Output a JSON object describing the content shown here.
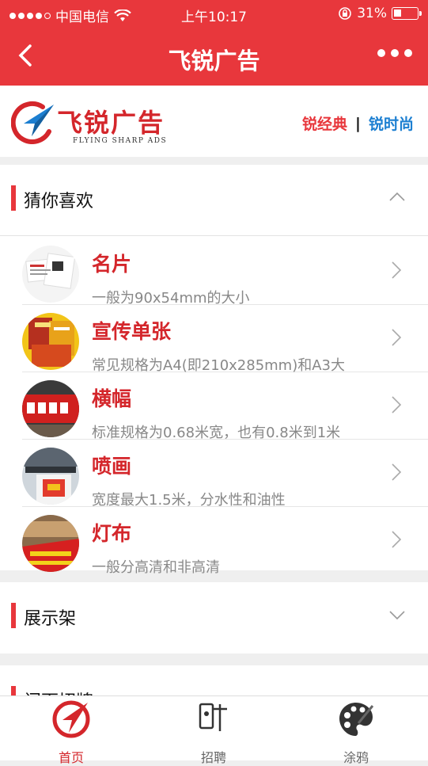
{
  "status": {
    "carrier": "中国电信",
    "time": "上午10:17",
    "battery": "31%"
  },
  "nav": {
    "title": "飞锐广告"
  },
  "header": {
    "brand_name": "飞锐广告",
    "brand_sub": "FLYING SHARP ADS",
    "link_a": "锐经典",
    "separator": "|",
    "link_b": "锐时尚"
  },
  "sections": [
    {
      "title": "猜你喜欢",
      "expanded": true
    },
    {
      "title": "展示架",
      "expanded": false
    },
    {
      "title": "门面招牌",
      "expanded": false
    }
  ],
  "items": [
    {
      "name": "名片",
      "desc": "一般为90x54mm的大小"
    },
    {
      "name": "宣传单张",
      "desc": "常见规格为A4(即210x285mm)和A3大"
    },
    {
      "name": "横幅",
      "desc": "标准规格为0.68米宽，也有0.8米到1米"
    },
    {
      "name": "喷画",
      "desc": "宽度最大1.5米，分水性和油性"
    },
    {
      "name": "灯布",
      "desc": "一般分高清和非高清"
    }
  ],
  "tabs": [
    {
      "label": "首页",
      "icon": "home-logo-icon",
      "active": true
    },
    {
      "label": "招聘",
      "icon": "recruit-icon",
      "active": false
    },
    {
      "label": "涂鸦",
      "icon": "palette-icon",
      "active": false
    }
  ],
  "colors": {
    "accent": "#e8373c",
    "link_blue": "#1c7fd1"
  }
}
